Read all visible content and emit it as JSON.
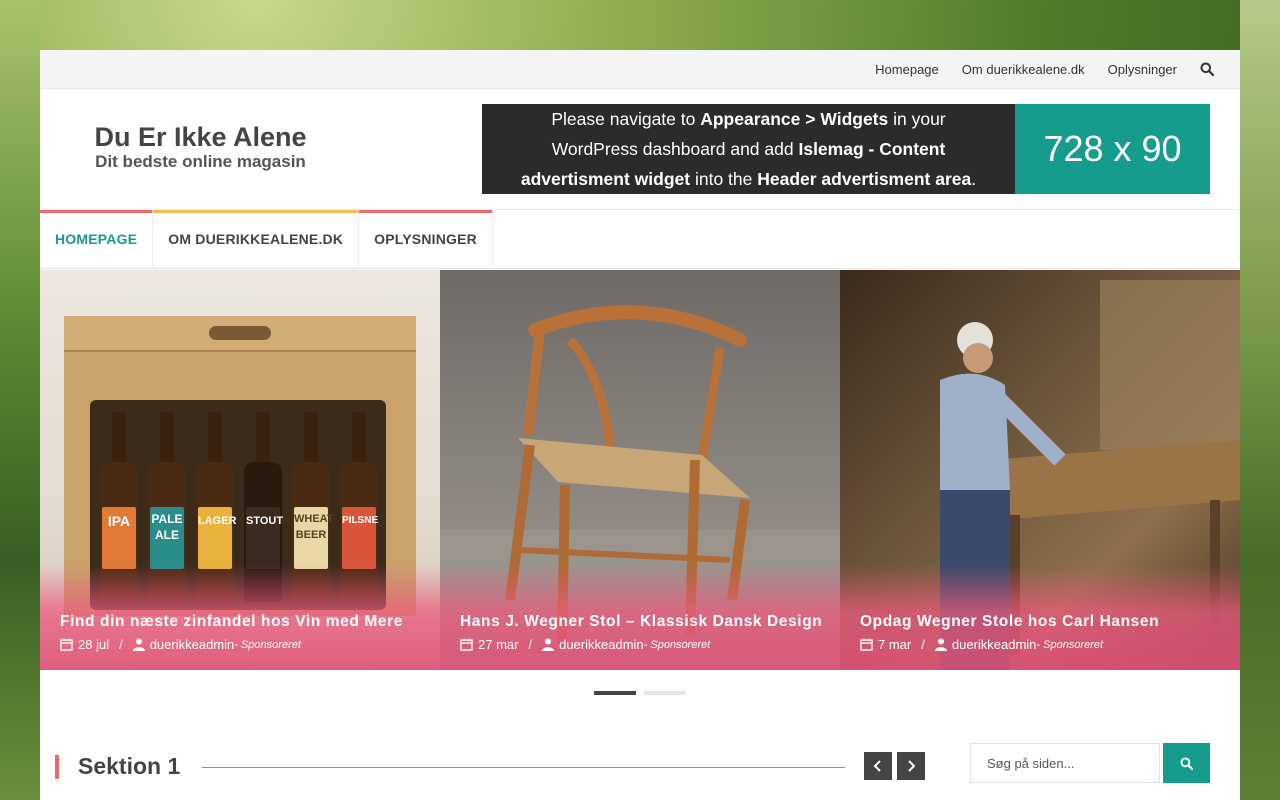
{
  "topbar": {
    "links": [
      "Homepage",
      "Om duerikkealene.dk",
      "Oplysninger"
    ]
  },
  "brand": {
    "title": "Du Er Ikke Alene",
    "tagline": "Dit bedste online magasin"
  },
  "ad": {
    "line1_pre": "Please navigate to ",
    "line1_bold": "Appearance > Widgets",
    "line1_post": " in your",
    "line2_pre": "WordPress dashboard and add ",
    "line2_bold": "Islemag - Content",
    "line3_bold": "advertisment widget",
    "line3_mid": " into the ",
    "line3_bold2": "Header advertisment area",
    "line3_post": ".",
    "size": "728 x 90"
  },
  "nav": {
    "items": [
      "HOMEPAGE",
      "OM DUERIKKEALENE.DK",
      "OPLYSNINGER"
    ]
  },
  "slides": [
    {
      "title": "Find din næste zinfandel hos Vin med Mere",
      "date": "28 jul",
      "author": "duerikkeadmin",
      "sponsor": "- Sponsoreret",
      "labels": [
        "IPA",
        "PALE ALE",
        "LAGER",
        "STOUT",
        "WHEAT BEER",
        "PILSNE"
      ]
    },
    {
      "title": "Hans J. Wegner Stol – Klassisk Dansk Design",
      "date": "27 mar",
      "author": "duerikkeadmin",
      "sponsor": "- Sponsoreret"
    },
    {
      "title": "Opdag Wegner Stole hos Carl Hansen",
      "date": "7 mar",
      "author": "duerikkeadmin",
      "sponsor": "- Sponsoreret"
    }
  ],
  "section": {
    "title": "Sektion 1"
  },
  "sidebar_search": {
    "placeholder": "Søg på siden..."
  },
  "colors": {
    "accent": "#159c8d",
    "red": "#e96a6a",
    "yellow": "#f4c04b",
    "dark": "#444444"
  }
}
